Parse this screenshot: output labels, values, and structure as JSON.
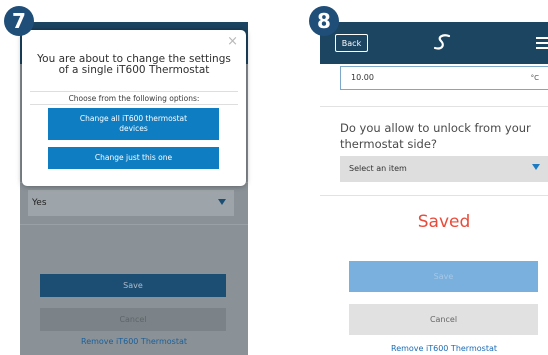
{
  "steps": {
    "left": "7",
    "right": "8"
  },
  "colors": {
    "header": "#1c4562",
    "primary_button": "#0e7dc1",
    "saved_text": "#e84b3a",
    "link": "#1b6bb5"
  },
  "left_screen": {
    "dialog": {
      "close_icon": "×",
      "title": "You are about to change the settings of a single iT600 Thermostat",
      "hint": "Choose from the following options:",
      "option_all": "Change all iT600 thermostat devices",
      "option_one": "Change just this one"
    },
    "select_value": "Yes",
    "save_label": "Save",
    "cancel_label": "Cancel",
    "remove_link": "Remove iT600 Thermostat"
  },
  "right_screen": {
    "back_label": "Back",
    "logo_icon": "salus-logo-icon",
    "menu_icon": "hamburger-menu-icon",
    "temperature_value": "10.00",
    "temperature_unit": "°C",
    "question": "Do you allow to unlock from your thermostat side?",
    "select_placeholder": "Select an item",
    "status": "Saved",
    "save_label": "Save",
    "cancel_label": "Cancel",
    "remove_link": "Remove iT600 Thermostat"
  }
}
